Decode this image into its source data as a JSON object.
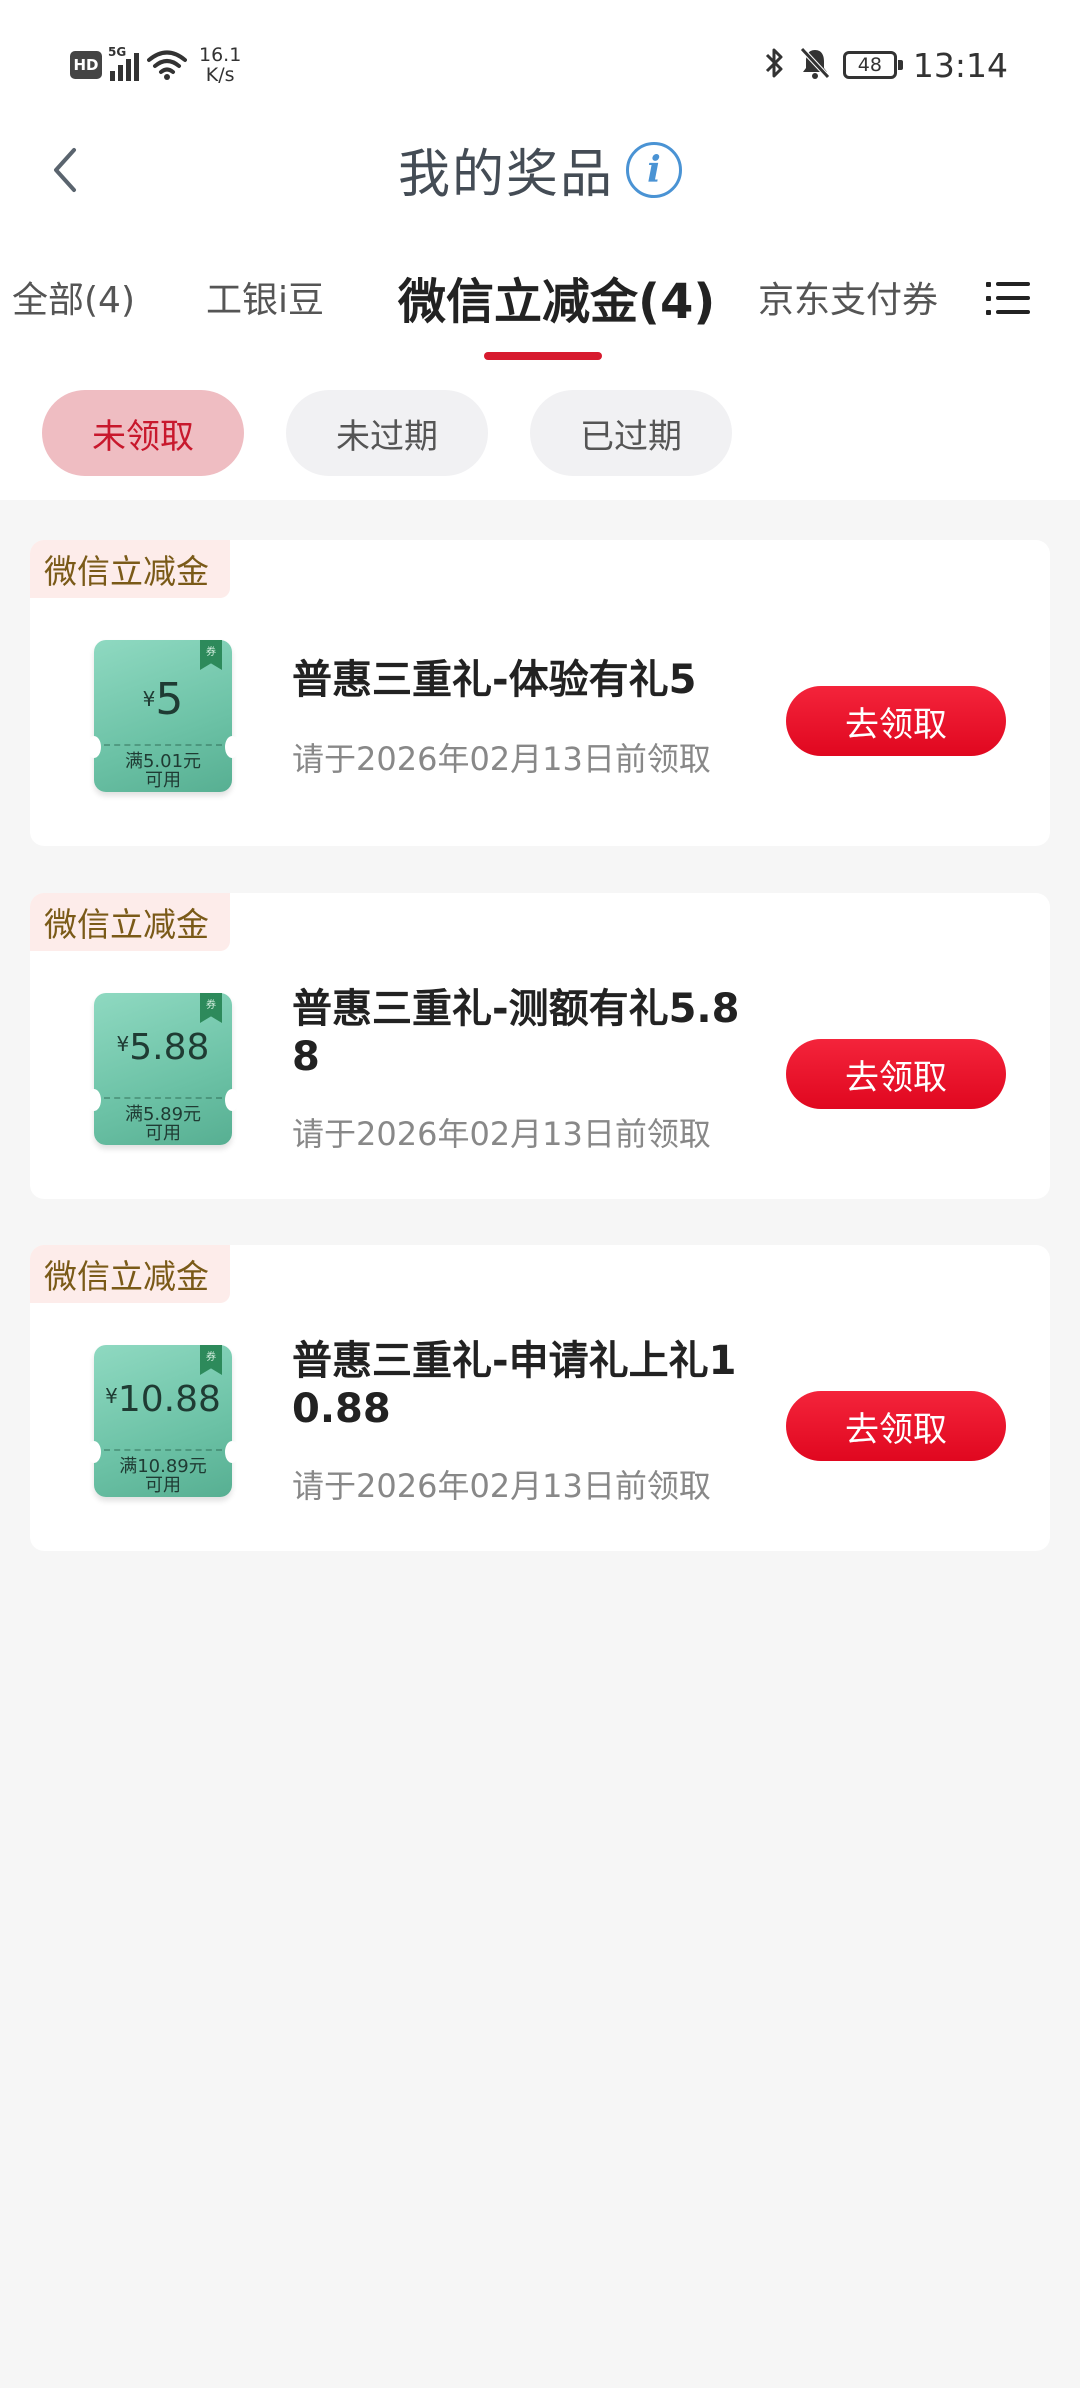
{
  "status_bar": {
    "hd": "HD",
    "network": "5G",
    "speed_value": "16.1",
    "speed_unit": "K/s",
    "battery": "48",
    "time": "13:14"
  },
  "header": {
    "title": "我的奖品",
    "info_glyph": "i"
  },
  "tabs": [
    {
      "label": "全部(4)"
    },
    {
      "label": "工银i豆"
    },
    {
      "label": "微信立减金(4)",
      "active": true
    },
    {
      "label": "京东支付券"
    }
  ],
  "filters": [
    {
      "label": "未领取",
      "active": true
    },
    {
      "label": "未过期"
    },
    {
      "label": "已过期"
    }
  ],
  "prizes": [
    {
      "tag": "微信立减金",
      "coupon_flag": "券",
      "coupon_currency": "¥",
      "coupon_amount": "5",
      "coupon_condition_1": "满5.01元",
      "coupon_condition_2": "可用",
      "title": "普惠三重礼-体验有礼5",
      "expiry": "请于2026年02月13日前领取",
      "action": "去领取"
    },
    {
      "tag": "微信立减金",
      "coupon_flag": "券",
      "coupon_currency": "¥",
      "coupon_amount": "5.88",
      "coupon_condition_1": "满5.89元",
      "coupon_condition_2": "可用",
      "title": "普惠三重礼-测额有礼5.88",
      "expiry": "请于2026年02月13日前领取",
      "action": "去领取"
    },
    {
      "tag": "微信立减金",
      "coupon_flag": "券",
      "coupon_currency": "¥",
      "coupon_amount": "10.88",
      "coupon_condition_1": "满10.89元",
      "coupon_condition_2": "可用",
      "title": "普惠三重礼-申请礼上礼10.88",
      "expiry": "请于2026年02月13日前领取",
      "action": "去领取"
    }
  ],
  "icons": {
    "back": "chevron-left-icon",
    "info": "info-icon",
    "menu": "list-menu-icon",
    "bluetooth": "bluetooth-icon",
    "mute": "bell-off-icon",
    "wifi": "wifi-icon",
    "signal": "signal-icon"
  },
  "colors": {
    "accent_red": "#e0071f",
    "tab_underline": "#d71a2e",
    "active_filter_bg": "#efbdc2",
    "coupon_green": "#6cc2a6",
    "tag_text": "#7a5a18"
  }
}
